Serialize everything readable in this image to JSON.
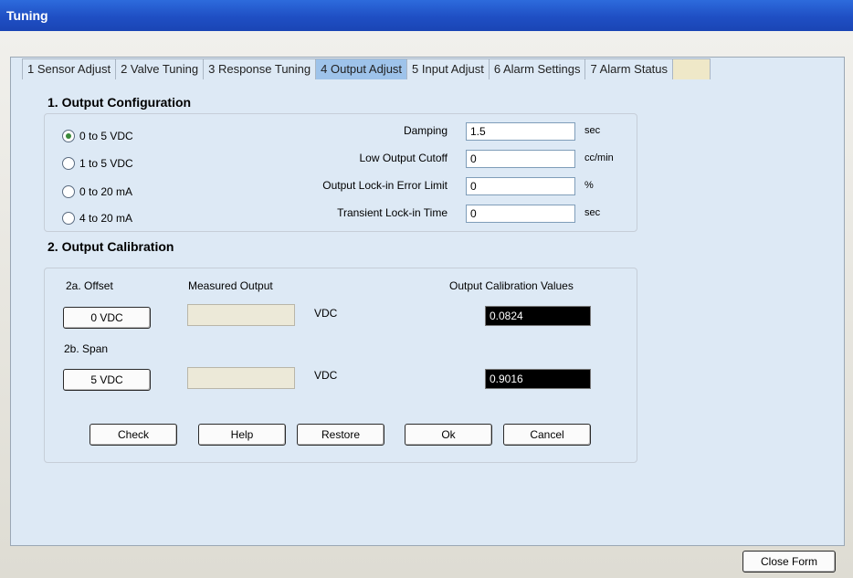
{
  "window": {
    "title": "Tuning"
  },
  "tabs": [
    {
      "label": "1 Sensor Adjust",
      "active": false
    },
    {
      "label": "2 Valve Tuning",
      "active": false
    },
    {
      "label": "3 Response Tuning",
      "active": false
    },
    {
      "label": "4 Output Adjust",
      "active": true
    },
    {
      "label": "5 Input Adjust",
      "active": false
    },
    {
      "label": "6 Alarm Settings",
      "active": false
    },
    {
      "label": "7 Alarm Status",
      "active": false
    }
  ],
  "output_config": {
    "title": "1. Output Configuration",
    "radios": [
      {
        "label": "0 to 5 VDC",
        "checked": true
      },
      {
        "label": "1 to 5 VDC",
        "checked": false
      },
      {
        "label": "0 to 20 mA",
        "checked": false
      },
      {
        "label": "4 to 20 mA",
        "checked": false
      }
    ],
    "fields": [
      {
        "label": "Damping",
        "value": "1.5",
        "unit": "sec"
      },
      {
        "label": "Low Output Cutoff",
        "value": "0",
        "unit": "cc/min"
      },
      {
        "label": "Output Lock-in Error Limit",
        "value": "0",
        "unit": "%"
      },
      {
        "label": "Transient Lock-in Time",
        "value": "0",
        "unit": "sec"
      }
    ]
  },
  "output_calibration": {
    "title": "2. Output Calibration",
    "offset_label": "2a. Offset",
    "measured_label": "Measured Output",
    "values_label": "Output Calibration Values",
    "span_label": "2b. Span",
    "offset_button": "0 VDC",
    "span_button": "5 VDC",
    "unit": "VDC",
    "offset_value": "0.0824",
    "span_value": "0.9016"
  },
  "buttons": {
    "check": "Check",
    "help": "Help",
    "restore": "Restore",
    "ok": "Ok",
    "cancel": "Cancel",
    "close_form": "Close Form"
  },
  "colors": {
    "title_bar": "#1f4fc4",
    "active_tab": "#9ec3ea",
    "panel": "#dde9f5"
  }
}
